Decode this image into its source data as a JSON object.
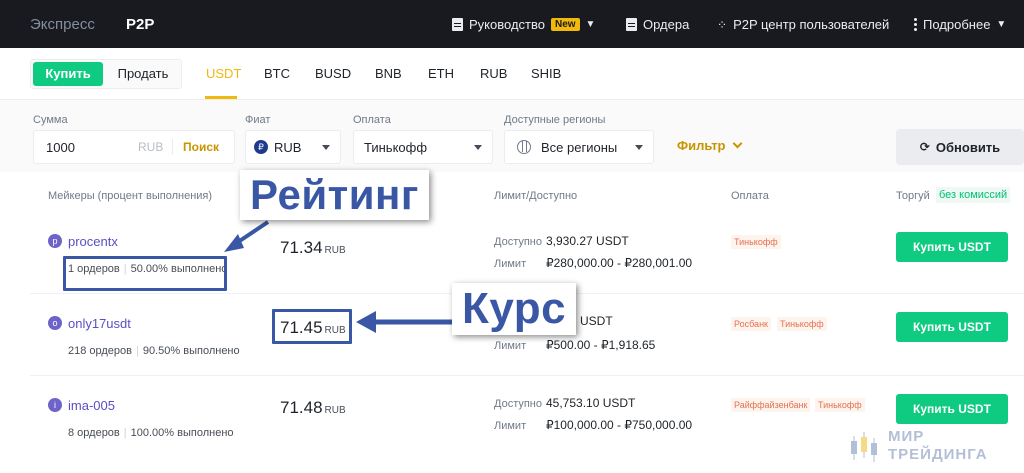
{
  "topbar": {
    "modes": [
      "Экспресс",
      "P2P"
    ],
    "guide_label": "Руководство",
    "guide_badge": "New",
    "orders_label": "Ордера",
    "user_center_label": "P2P центр пользователей",
    "more_label": "Подробнее"
  },
  "trade_toggle": {
    "buy": "Купить",
    "sell": "Продать"
  },
  "assets": [
    "USDT",
    "BTC",
    "BUSD",
    "BNB",
    "ETH",
    "RUB",
    "SHIB"
  ],
  "active_asset": "USDT",
  "filters": {
    "amount_label": "Сумма",
    "amount_value": "1000",
    "amount_currency": "RUB",
    "search_label": "Поиск",
    "fiat_label": "Фиат",
    "fiat_value": "RUB",
    "fiat_icon": "₽",
    "payment_label": "Оплата",
    "payment_value": "Тинькофф",
    "regions_label": "Доступные регионы",
    "regions_value": "Все регионы",
    "filter_link": "Фильтр",
    "refresh_label": "Обновить"
  },
  "table_headers": {
    "makers": "Мейкеры (процент выполнения)",
    "limit": "Лимит/Доступно",
    "payment": "Оплата",
    "trade": "Торгуй",
    "no_fee": "без комиссий"
  },
  "rows": [
    {
      "initial": "p",
      "name": "procentx",
      "orders": "1 ордеров",
      "completion": "50.00% выполнено",
      "price": "71.34",
      "currency": "RUB",
      "available_label": "Доступно",
      "available": "3,930.27 USDT",
      "limit_label": "Лимит",
      "limit": "₽280,000.00 - ₽280,001.00",
      "payments": [
        "Тинькофф"
      ],
      "button": "Купить USDT"
    },
    {
      "initial": "o",
      "name": "only17usdt",
      "orders": "218 ордеров",
      "completion": "90.50% выполнено",
      "price": "71.45",
      "currency": "RUB",
      "available_label": "Доступно",
      "available": "USDT",
      "limit_label": "Лимит",
      "limit": "₽500.00 - ₽1,918.65",
      "payments": [
        "Росбанк",
        "Тинькофф"
      ],
      "button": "Купить USDT"
    },
    {
      "initial": "i",
      "name": "ima-005",
      "orders": "8 ордеров",
      "completion": "100.00% выполнено",
      "price": "71.48",
      "currency": "RUB",
      "available_label": "Доступно",
      "available": "45,753.10 USDT",
      "limit_label": "Лимит",
      "limit": "₽100,000.00 - ₽750,000.00",
      "payments": [
        "Райффайзенбанк",
        "Тинькофф"
      ],
      "button": "Купить USDT"
    }
  ],
  "annotations": {
    "rating": "Рейтинг",
    "rate": "Курс"
  },
  "watermark": {
    "line1": "МИР",
    "line2": "ТРЕЙДИНГА"
  },
  "colors": {
    "topbar": "#181a20",
    "accent": "#f0b90b",
    "buy": "#0ecb81",
    "annotation": "#3a57a5"
  }
}
